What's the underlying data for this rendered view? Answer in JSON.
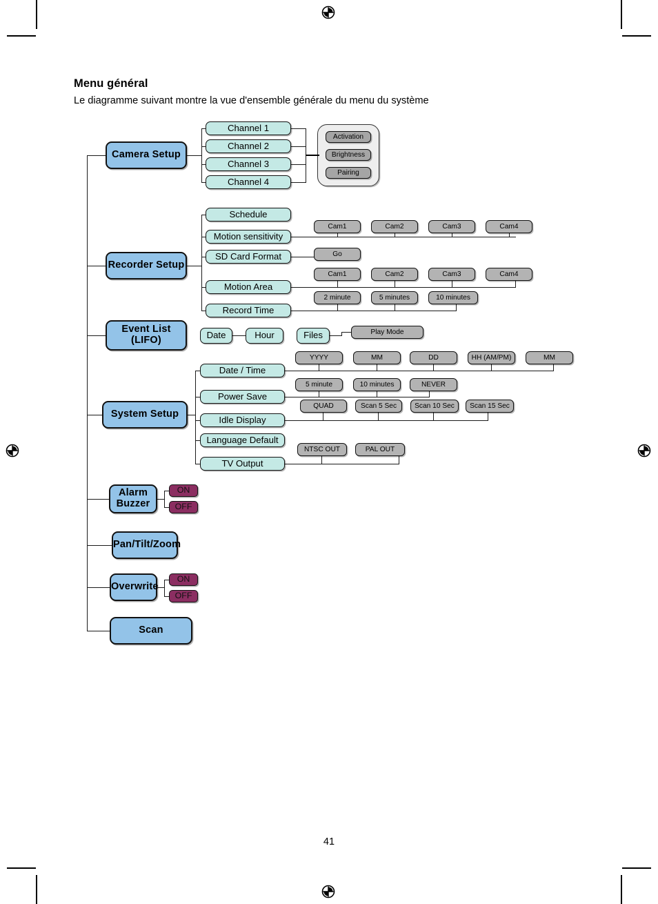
{
  "document": {
    "heading": "Menu général",
    "subheading": "Le diagramme suivant montre la vue d'ensemble générale du menu du système",
    "page_number": "41"
  },
  "colors": {
    "primary_node": "#93c3e8",
    "sub_node": "#c4e9e5",
    "option_node": "#b3b3b3",
    "toggle_node": "#8b2e61",
    "panel": "#eeeeee",
    "line": "#1a1a1a"
  },
  "diagram": {
    "type": "menu-tree",
    "root_label": "Menu",
    "branches": [
      {
        "id": "camera-setup",
        "label": "Camera Setup",
        "children": [
          {
            "label": "Channel 1"
          },
          {
            "label": "Channel 2"
          },
          {
            "label": "Channel 3"
          },
          {
            "label": "Channel 4"
          }
        ],
        "shared_options_panel": [
          {
            "label": "Activation"
          },
          {
            "label": "Brightness"
          },
          {
            "label": "Pairing"
          }
        ]
      },
      {
        "id": "recorder-setup",
        "label": "Recorder Setup",
        "children": [
          {
            "label": "Schedule",
            "options": []
          },
          {
            "label": "Motion sensitivity",
            "options": [
              {
                "label": "Cam1"
              },
              {
                "label": "Cam2"
              },
              {
                "label": "Cam3"
              },
              {
                "label": "Cam4"
              }
            ]
          },
          {
            "label": "SD Card Format",
            "options": [
              {
                "label": "Go"
              }
            ]
          },
          {
            "label": "Motion Area",
            "options": [
              {
                "label": "Cam1"
              },
              {
                "label": "Cam2"
              },
              {
                "label": "Cam3"
              },
              {
                "label": "Cam4"
              }
            ]
          },
          {
            "label": "Record Time",
            "options": [
              {
                "label": "2 minute"
              },
              {
                "label": "5 minutes"
              },
              {
                "label": "10 minutes"
              }
            ]
          }
        ]
      },
      {
        "id": "event-list",
        "label_line1": "Event List",
        "label_line2": "(LIFO)",
        "children": [
          {
            "label": "Date"
          },
          {
            "label": "Hour"
          },
          {
            "label": "Files"
          }
        ],
        "options": [
          {
            "label": "Play Mode"
          }
        ]
      },
      {
        "id": "system-setup",
        "label": "System Setup",
        "children": [
          {
            "label": "Date / Time",
            "options": [
              {
                "label": "YYYY"
              },
              {
                "label": "MM"
              },
              {
                "label": "DD"
              },
              {
                "label": "HH (AM/PM)"
              },
              {
                "label": "MM"
              }
            ]
          },
          {
            "label": "Power Save",
            "options": [
              {
                "label": "5 minute"
              },
              {
                "label": "10 minutes"
              },
              {
                "label": "NEVER"
              }
            ]
          },
          {
            "label": "Idle Display",
            "options": [
              {
                "label": "QUAD"
              },
              {
                "label": "Scan 5 Sec"
              },
              {
                "label": "Scan 10 Sec"
              },
              {
                "label": "Scan 15 Sec"
              }
            ]
          },
          {
            "label": "Language Default",
            "options": []
          },
          {
            "label": "TV Output",
            "options": [
              {
                "label": "NTSC OUT"
              },
              {
                "label": "PAL OUT"
              }
            ]
          }
        ]
      },
      {
        "id": "alarm-buzzer",
        "label_line1": "Alarm",
        "label_line2": "Buzzer",
        "toggles": [
          {
            "label": "ON"
          },
          {
            "label": "OFF"
          }
        ]
      },
      {
        "id": "pan-tilt-zoom",
        "label": "Pan/Tilt/Zoom",
        "toggles": []
      },
      {
        "id": "overwrite",
        "label": "Overwrite",
        "toggles": [
          {
            "label": "ON"
          },
          {
            "label": "OFF"
          }
        ]
      },
      {
        "id": "scan",
        "label": "Scan",
        "toggles": []
      }
    ]
  }
}
